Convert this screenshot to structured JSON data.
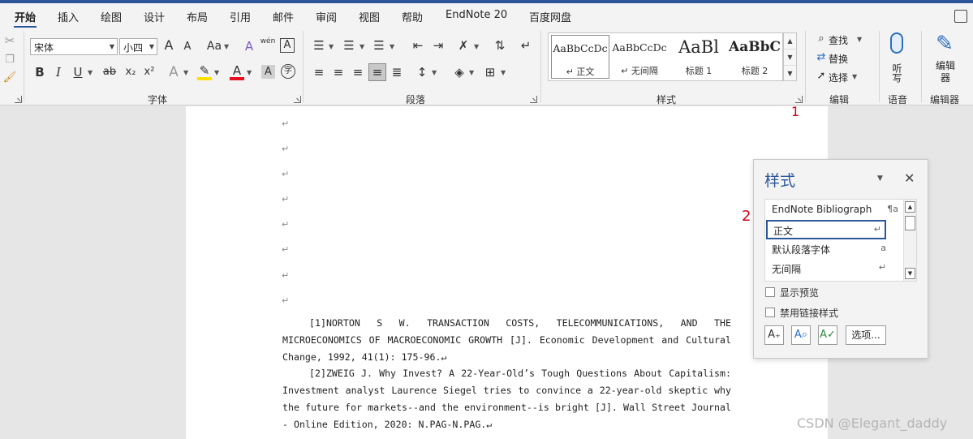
{
  "tabs": [
    "开始",
    "插入",
    "绘图",
    "设计",
    "布局",
    "引用",
    "邮件",
    "审阅",
    "视图",
    "帮助",
    "EndNote 20",
    "百度网盘"
  ],
  "font_group": {
    "font_name": "宋体",
    "font_size": "小四",
    "label": "字体",
    "btn_grow": "A",
    "btn_shrink": "A",
    "btn_case": "Aa",
    "btn_phonetic": "wén",
    "btn_border": "A",
    "btn_bold": "B",
    "btn_italic": "I",
    "btn_underline": "U",
    "btn_strike": "ab",
    "btn_sub": "x₂",
    "btn_sup": "x²",
    "btn_effects": "A",
    "btn_color": "A",
    "btn_shade": "A",
    "btn_enclose": "字"
  },
  "paragraph_group": {
    "label": "段落"
  },
  "styles_group": {
    "label": "样式",
    "items": [
      {
        "preview": "AaBbCcDc",
        "name": "↵ 正文"
      },
      {
        "preview": "AaBbCcDc",
        "name": "↵ 无间隔"
      },
      {
        "preview": "AaBl",
        "name": "标题 1"
      },
      {
        "preview": "AaBbC",
        "name": "标题 2"
      }
    ]
  },
  "editing_group": {
    "label": "编辑",
    "find": "查找",
    "replace": "替换",
    "select": "选择"
  },
  "voice_group": {
    "label": "语音",
    "dictate": "听写"
  },
  "editor_group": {
    "label": "编辑器",
    "editor": "编辑器"
  },
  "annotations": {
    "one": "1",
    "two": "2"
  },
  "document": {
    "paragraph_mark": "↵",
    "ref1": "[1]NORTON S W. TRANSACTION COSTS, TELECOMMUNICATIONS, AND THE MICROECONOMICS OF MACROECONOMIC GROWTH [J]. Economic Development and Cultural Change, 1992, 41(1): 175-96.↵",
    "ref2": "[2]ZWEIG J. Why Invest? A 22-Year-Old’s Tough Questions About Capitalism: Investment analyst Laurence Siegel tries to convince a 22-year-old skeptic why the future for markets--and the environment--is bright [J]. Wall Street Journal - Online Edition, 2020: N.PAG-N.PAG.↵"
  },
  "styles_pane": {
    "title": "样式",
    "items": [
      {
        "name": "EndNote Bibliograph",
        "marker": "¶a"
      },
      {
        "name": "正文",
        "marker": "↵"
      },
      {
        "name": "默认段落字体",
        "marker": "a"
      },
      {
        "name": "无间隔",
        "marker": "↵"
      }
    ],
    "show_preview": "显示预览",
    "disable_linked": "禁用链接样式",
    "options_button": "选项..."
  },
  "watermark": "CSDN @Elegant_daddy"
}
